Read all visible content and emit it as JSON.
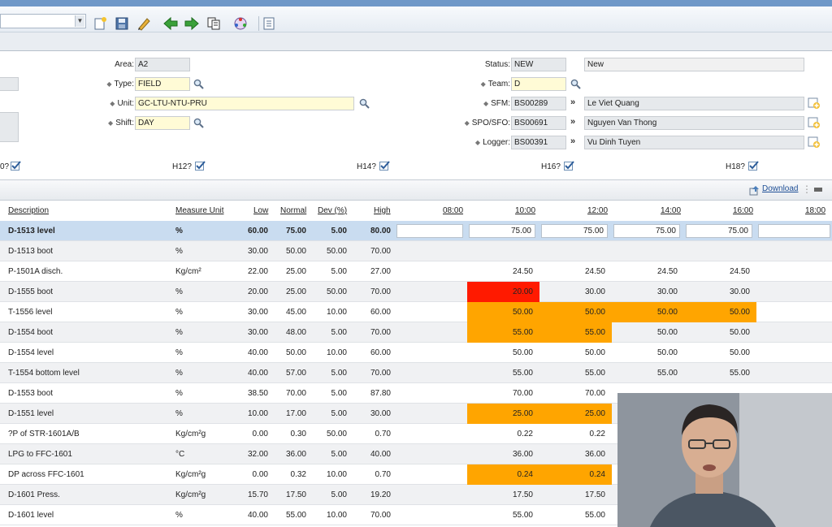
{
  "toolbar": {
    "combo_value": "",
    "buttons": [
      "new-icon",
      "save-icon",
      "edit-icon",
      "back-arrow-icon",
      "forward-arrow-icon",
      "copy-icon",
      "workflow-icon",
      "report-icon"
    ]
  },
  "form": {
    "area": {
      "label": "Area:",
      "value": "A2"
    },
    "type": {
      "label": "Type:",
      "value": "FIELD"
    },
    "unit": {
      "label": "Unit:",
      "value": "GC-LTU-NTU-PRU"
    },
    "shift": {
      "label": "Shift:",
      "value": "DAY"
    },
    "status": {
      "label": "Status:",
      "value": "NEW",
      "text": "New"
    },
    "team": {
      "label": "Team:",
      "value": "D"
    },
    "sfm": {
      "label": "SFM:",
      "code": "BS00289",
      "name": "Le Viet Quang"
    },
    "spo": {
      "label": "SPO/SFO:",
      "code": "BS00691",
      "name": "Nguyen Van Thong"
    },
    "logger": {
      "label": "Logger:",
      "code": "BS00391",
      "name": "Vu Dinh Tuyen"
    },
    "checks": [
      {
        "label": "0?",
        "checked": true
      },
      {
        "label": "H12?",
        "checked": true
      },
      {
        "label": "H14?",
        "checked": true
      },
      {
        "label": "H16?",
        "checked": true
      },
      {
        "label": "H18?",
        "checked": true
      }
    ]
  },
  "grid": {
    "download_label": "Download",
    "headers": {
      "description": "Description",
      "unit": "Measure Unit",
      "low": "Low",
      "normal": "Normal",
      "dev": "Dev (%)",
      "high": "High",
      "t0800": "08:00",
      "t1000": "10:00",
      "t1200": "12:00",
      "t1400": "14:00",
      "t1600": "16:00",
      "t1800": "18:00"
    },
    "colors": {
      "red": "#ff1a00",
      "orange": "#ffa500",
      "selected": "#c9dcf0"
    },
    "rows": [
      {
        "desc": "D-1513 level",
        "unit": "%",
        "low": "60.00",
        "normal": "75.00",
        "dev": "5.00",
        "high": "80.00",
        "v": [
          "",
          "75.00",
          "75.00",
          "75.00",
          "75.00",
          ""
        ],
        "c": [
          "",
          "",
          "",
          "",
          "",
          ""
        ]
      },
      {
        "desc": "D-1513 boot",
        "unit": "%",
        "low": "30.00",
        "normal": "50.00",
        "dev": "50.00",
        "high": "70.00",
        "v": [
          "",
          "",
          "",
          "",
          "",
          ""
        ],
        "c": [
          "",
          "",
          "",
          "",
          "",
          ""
        ]
      },
      {
        "desc": "P-1501A disch.",
        "unit": "Kg/cm²",
        "low": "22.00",
        "normal": "25.00",
        "dev": "5.00",
        "high": "27.00",
        "v": [
          "",
          "24.50",
          "24.50",
          "24.50",
          "24.50",
          ""
        ],
        "c": [
          "",
          "",
          "",
          "",
          "",
          ""
        ]
      },
      {
        "desc": "D-1555 boot",
        "unit": "%",
        "low": "20.00",
        "normal": "25.00",
        "dev": "50.00",
        "high": "70.00",
        "v": [
          "",
          "20.00",
          "30.00",
          "30.00",
          "30.00",
          ""
        ],
        "c": [
          "",
          "red",
          "",
          "",
          "",
          ""
        ]
      },
      {
        "desc": "T-1556 level",
        "unit": "%",
        "low": "30.00",
        "normal": "45.00",
        "dev": "10.00",
        "high": "60.00",
        "v": [
          "",
          "50.00",
          "50.00",
          "50.00",
          "50.00",
          ""
        ],
        "c": [
          "",
          "orange",
          "orange",
          "orange",
          "orange",
          ""
        ]
      },
      {
        "desc": "D-1554 boot",
        "unit": "%",
        "low": "30.00",
        "normal": "48.00",
        "dev": "5.00",
        "high": "70.00",
        "v": [
          "",
          "55.00",
          "55.00",
          "50.00",
          "50.00",
          ""
        ],
        "c": [
          "",
          "orange",
          "orange",
          "",
          "",
          ""
        ]
      },
      {
        "desc": "D-1554 level",
        "unit": "%",
        "low": "40.00",
        "normal": "50.00",
        "dev": "10.00",
        "high": "60.00",
        "v": [
          "",
          "50.00",
          "50.00",
          "50.00",
          "50.00",
          ""
        ],
        "c": [
          "",
          "",
          "",
          "",
          "",
          ""
        ]
      },
      {
        "desc": "T-1554 bottom level",
        "unit": "%",
        "low": "40.00",
        "normal": "57.00",
        "dev": "5.00",
        "high": "70.00",
        "v": [
          "",
          "55.00",
          "55.00",
          "55.00",
          "55.00",
          ""
        ],
        "c": [
          "",
          "",
          "",
          "",
          "",
          ""
        ]
      },
      {
        "desc": "D-1553 boot",
        "unit": "%",
        "low": "38.50",
        "normal": "70.00",
        "dev": "5.00",
        "high": "87.80",
        "v": [
          "",
          "70.00",
          "70.00",
          "",
          "",
          ""
        ],
        "c": [
          "",
          "",
          "",
          "",
          "",
          ""
        ]
      },
      {
        "desc": "D-1551 level",
        "unit": "%",
        "low": "10.00",
        "normal": "17.00",
        "dev": "5.00",
        "high": "30.00",
        "v": [
          "",
          "25.00",
          "25.00",
          "",
          "",
          ""
        ],
        "c": [
          "",
          "orange",
          "orange",
          "",
          "",
          ""
        ]
      },
      {
        "desc": "?P of STR-1601A/B",
        "unit": "Kg/cm²g",
        "low": "0.00",
        "normal": "0.30",
        "dev": "50.00",
        "high": "0.70",
        "v": [
          "",
          "0.22",
          "0.22",
          "",
          "",
          ""
        ],
        "c": [
          "",
          "",
          "",
          "",
          "",
          ""
        ]
      },
      {
        "desc": "LPG to FFC-1601",
        "unit": "°C",
        "low": "32.00",
        "normal": "36.00",
        "dev": "5.00",
        "high": "40.00",
        "v": [
          "",
          "36.00",
          "36.00",
          "",
          "",
          ""
        ],
        "c": [
          "",
          "",
          "",
          "",
          "",
          ""
        ]
      },
      {
        "desc": "DP across FFC-1601",
        "unit": "Kg/cm²g",
        "low": "0.00",
        "normal": "0.32",
        "dev": "10.00",
        "high": "0.70",
        "v": [
          "",
          "0.24",
          "0.24",
          "",
          "",
          ""
        ],
        "c": [
          "",
          "orange",
          "orange",
          "",
          "",
          ""
        ]
      },
      {
        "desc": "D-1601 Press.",
        "unit": "Kg/cm²g",
        "low": "15.70",
        "normal": "17.50",
        "dev": "5.00",
        "high": "19.20",
        "v": [
          "",
          "17.50",
          "17.50",
          "",
          "",
          ""
        ],
        "c": [
          "",
          "",
          "",
          "",
          "",
          ""
        ]
      },
      {
        "desc": "D-1601 level",
        "unit": "%",
        "low": "40.00",
        "normal": "55.00",
        "dev": "10.00",
        "high": "70.00",
        "v": [
          "",
          "55.00",
          "55.00",
          "",
          "",
          ""
        ],
        "c": [
          "",
          "",
          "",
          "",
          "",
          ""
        ]
      }
    ]
  }
}
